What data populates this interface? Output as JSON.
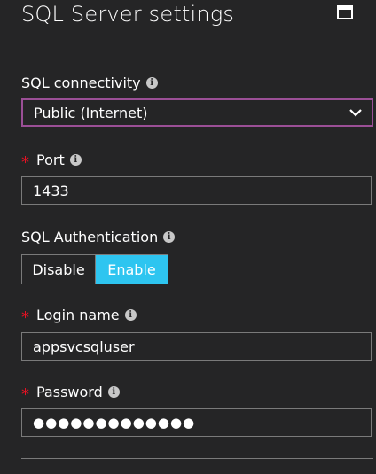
{
  "header": {
    "title": "SQL Server settings"
  },
  "connectivity": {
    "label": "SQL connectivity",
    "selected": "Public (Internet)"
  },
  "port": {
    "label": "Port",
    "value": "1433"
  },
  "authentication": {
    "label": "SQL Authentication",
    "options": [
      "Disable",
      "Enable"
    ],
    "selected": "Enable"
  },
  "login": {
    "label": "Login name",
    "value": "appsvcsqluser"
  },
  "password": {
    "label": "Password",
    "masked_value": "●●●●●●●●●●●●●"
  },
  "icons": {
    "info": "info-icon",
    "maximize": "maximize-icon",
    "chevron": "chevron-down-icon",
    "required": "required-star"
  },
  "colors": {
    "background": "#252526",
    "accent_enabled": "#2ec5f0",
    "dropdown_focus_border": "#9b4f96",
    "required_star": "#e81123",
    "input_border": "#7a7a7a"
  }
}
